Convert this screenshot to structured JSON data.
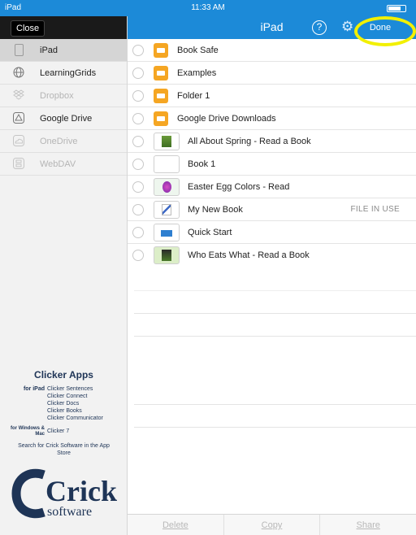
{
  "status_bar": {
    "carrier": "iPad",
    "time": "11:33 AM"
  },
  "sidebar": {
    "close_label": "Close",
    "sources": [
      {
        "label": "iPad",
        "icon": "ipad-device-icon",
        "state": "selected"
      },
      {
        "label": "LearningGrids",
        "icon": "globe-icon",
        "state": "enabled"
      },
      {
        "label": "Dropbox",
        "icon": "dropbox-icon",
        "state": "disabled"
      },
      {
        "label": "Google Drive",
        "icon": "google-drive-icon",
        "state": "enabled"
      },
      {
        "label": "OneDrive",
        "icon": "onedrive-icon",
        "state": "disabled"
      },
      {
        "label": "WebDAV",
        "icon": "webdav-icon",
        "state": "disabled"
      }
    ],
    "promo": {
      "title": "Clicker Apps",
      "ipad_lead": "for iPad",
      "ipad_apps": [
        "Clicker Sentences",
        "Clicker Connect",
        "Clicker Docs",
        "Clicker Books",
        "Clicker Communicator"
      ],
      "desktop_lead": "for Windows & Mac",
      "desktop_apps": [
        "Clicker 7"
      ],
      "search_text": "Search for Crick Software in the App Store",
      "logo_main": "Crick",
      "logo_sub": "software"
    }
  },
  "header": {
    "title": "iPad",
    "help_symbol": "?",
    "done_label": "Done"
  },
  "files": [
    {
      "name": "Book Safe",
      "kind": "folder",
      "status": ""
    },
    {
      "name": "Examples",
      "kind": "folder",
      "status": ""
    },
    {
      "name": "Folder 1",
      "kind": "folder",
      "status": ""
    },
    {
      "name": "Google Drive Downloads",
      "kind": "folder",
      "status": ""
    },
    {
      "name": "All About Spring - Read a Book",
      "kind": "book",
      "status": ""
    },
    {
      "name": "Book 1",
      "kind": "book",
      "status": ""
    },
    {
      "name": "Easter Egg Colors - Read",
      "kind": "book",
      "status": ""
    },
    {
      "name": "My New Book",
      "kind": "book",
      "status": "FILE IN USE"
    },
    {
      "name": "Quick Start",
      "kind": "book",
      "status": ""
    },
    {
      "name": "Who Eats What - Read a Book",
      "kind": "book",
      "status": ""
    }
  ],
  "toolbar": {
    "delete_label": "Delete",
    "copy_label": "Copy",
    "share_label": "Share"
  },
  "colors": {
    "header_blue": "#1c8ad8",
    "folder_orange": "#f5a623",
    "highlight_yellow": "#f2f000",
    "crick_navy": "#1e3456"
  }
}
